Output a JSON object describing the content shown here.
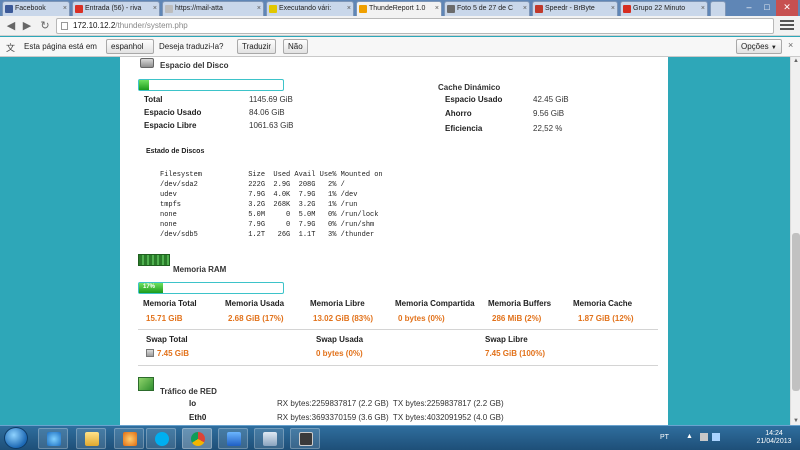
{
  "browser": {
    "tabs": [
      {
        "label": "Facebook",
        "color": "#3b5998",
        "active": false
      },
      {
        "label": "Entrada (56) - riva",
        "color": "#d93025",
        "active": false
      },
      {
        "label": "https://mail-atta",
        "color": "#888888",
        "active": false
      },
      {
        "label": "Executando vári:",
        "color": "#e1c700",
        "active": false
      },
      {
        "label": "ThundeReport 1.0",
        "color": "#f0a000",
        "active": true
      },
      {
        "label": "Foto 5 de 27 de C",
        "color": "#6b6b6b",
        "active": false
      },
      {
        "label": "Speedr - BrByte",
        "color": "#c0392b",
        "active": false
      },
      {
        "label": "Grupo 22 Minuto",
        "color": "#d62d20",
        "active": false
      }
    ],
    "address": {
      "host": "172.10.12.2",
      "path": "/thunder/system.php"
    },
    "translate_bar": {
      "prefix": "Esta página está em",
      "language": "espanhol",
      "question": "Deseja traduzi-la?",
      "translate_button": "Traduzir",
      "no_button": "Não",
      "options_button": "Opções"
    }
  },
  "disk": {
    "title": "Espacio del Disco",
    "percent": 1,
    "rows": [
      {
        "label": "Total",
        "value": "1145.69 GiB"
      },
      {
        "label": "Espacio Usado",
        "value": "84.06 GiB"
      },
      {
        "label": "Espacio Libre",
        "value": "1061.63 GiB"
      }
    ],
    "status_title": "Estado de Discos",
    "df_lines": [
      "Filesystem           Size  Used Avail Use% Mounted on",
      "/dev/sda2            222G  2.9G  208G   2% /",
      "udev                 7.9G  4.0K  7.9G   1% /dev",
      "tmpfs                3.2G  268K  3.2G   1% /run",
      "none                 5.0M     0  5.0M   0% /run/lock",
      "none                 7.9G     0  7.9G   0% /run/shm",
      "/dev/sdb5            1.2T   26G  1.1T   3% /thunder"
    ]
  },
  "cache": {
    "title": "Cache Dinámico",
    "rows": [
      {
        "label": "Espacio Usado",
        "value": "42.45 GiB"
      },
      {
        "label": "Ahorro",
        "value": "9.56 GiB"
      },
      {
        "label": "Eficiencia",
        "value": "22,52 %"
      }
    ]
  },
  "memory": {
    "title": "Memoria RAM",
    "percent": 17,
    "percent_label": "17%",
    "columns": [
      {
        "label": "Memoria Total",
        "value": "15.71 GiB"
      },
      {
        "label": "Memoria Usada",
        "value": "2.68 GiB (17%)"
      },
      {
        "label": "Memoria Libre",
        "value": "13.02 GiB (83%)"
      },
      {
        "label": "Memoria Compartida",
        "value": "0 bytes (0%)"
      },
      {
        "label": "Memoria Buffers",
        "value": "286 MiB (2%)"
      },
      {
        "label": "Memoria Cache",
        "value": "1.87 GiB (12%)"
      }
    ],
    "swap": [
      {
        "label": "Swap Total",
        "value": "7.45 GiB"
      },
      {
        "label": "Swap Usada",
        "value": "0 bytes (0%)"
      },
      {
        "label": "Swap Libre",
        "value": "7.45 GiB (100%)"
      }
    ]
  },
  "network": {
    "title": "Tráfico de RED",
    "interfaces": [
      {
        "name": "lo",
        "stats": "RX bytes:2259837817 (2.2 GB)  TX bytes:2259837817 (2.2 GB)"
      },
      {
        "name": "Eth0",
        "stats": "RX bytes:3693370159 (3.6 GB)  TX bytes:4032091952 (4.0 GB)"
      }
    ]
  },
  "taskbar": {
    "lang": "PT",
    "time": "14:24",
    "date": "21/04/2013"
  }
}
